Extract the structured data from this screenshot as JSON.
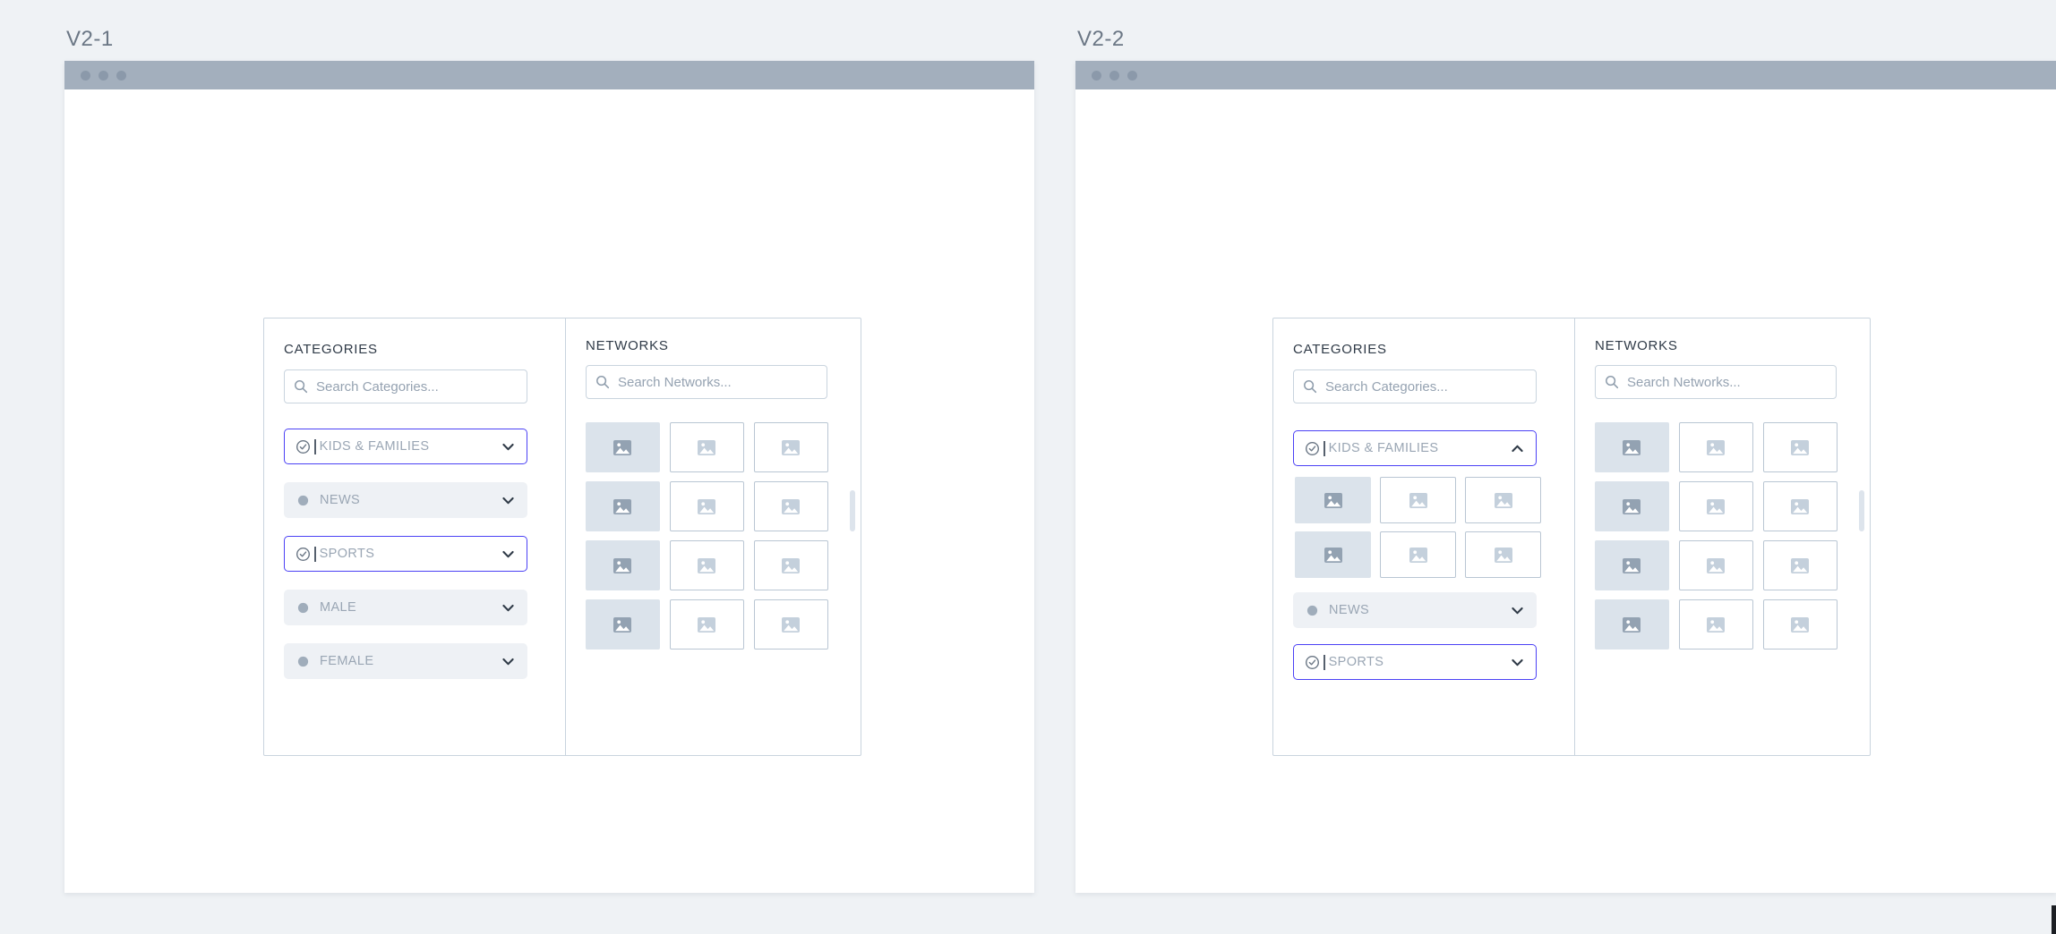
{
  "canvas": {
    "background": "#eff2f5"
  },
  "theme": {
    "accent": "#4b41f5",
    "chrome_bar": "#a3afbd",
    "chrome_dot": "#8b99aa",
    "panel_border": "#c9d4de",
    "row_unselected_bg": "#eef1f5",
    "label_muted": "#9aa6b4",
    "title_color": "#2f3a47",
    "tile_filled": "#dbe3eb",
    "tile_outline_border": "#b9c6d3",
    "scrollbar_thumb": "#dde4ec"
  },
  "artboards": [
    {
      "id": "v2-1",
      "label": "V2-1",
      "categories_panel": {
        "title": "CATEGORIES",
        "search": {
          "placeholder": "Search Categories...",
          "value": "",
          "icon": "search-icon"
        },
        "rows": [
          {
            "label": "KIDS & FAMILIES",
            "state": "selected",
            "marker": "check-circle-icon",
            "chevron": "chevron-down-icon",
            "expanded": false,
            "caret": true
          },
          {
            "label": "NEWS",
            "state": "unselected",
            "marker": "dot-icon",
            "chevron": "chevron-down-icon",
            "expanded": false,
            "caret": false
          },
          {
            "label": "SPORTS",
            "state": "selected",
            "marker": "check-circle-icon",
            "chevron": "chevron-down-icon",
            "expanded": false,
            "caret": true
          },
          {
            "label": "MALE",
            "state": "unselected",
            "marker": "dot-icon",
            "chevron": "chevron-down-icon",
            "expanded": false,
            "caret": false
          },
          {
            "label": "FEMALE",
            "state": "unselected",
            "marker": "dot-icon",
            "chevron": "chevron-down-icon",
            "expanded": false,
            "caret": false
          }
        ]
      },
      "networks_panel": {
        "title": "NETWORKS",
        "search": {
          "placeholder": "Search Networks...",
          "value": "",
          "icon": "search-icon"
        },
        "grid": {
          "columns": 3,
          "rows": 4,
          "tiles": [
            {
              "style": "filled",
              "icon": "image-placeholder-icon"
            },
            {
              "style": "outline",
              "icon": "image-placeholder-icon"
            },
            {
              "style": "outline",
              "icon": "image-placeholder-icon"
            },
            {
              "style": "filled",
              "icon": "image-placeholder-icon"
            },
            {
              "style": "outline",
              "icon": "image-placeholder-icon"
            },
            {
              "style": "outline",
              "icon": "image-placeholder-icon"
            },
            {
              "style": "filled",
              "icon": "image-placeholder-icon"
            },
            {
              "style": "outline",
              "icon": "image-placeholder-icon"
            },
            {
              "style": "outline",
              "icon": "image-placeholder-icon"
            },
            {
              "style": "filled",
              "icon": "image-placeholder-icon"
            },
            {
              "style": "outline",
              "icon": "image-placeholder-icon"
            },
            {
              "style": "outline",
              "icon": "image-placeholder-icon"
            }
          ]
        },
        "scrollbar": {
          "name": "networks-scrollbar-thumb"
        }
      }
    },
    {
      "id": "v2-2",
      "label": "V2-2",
      "categories_panel": {
        "title": "CATEGORIES",
        "search": {
          "placeholder": "Search Categories...",
          "value": "",
          "icon": "search-icon"
        },
        "rows": [
          {
            "label": "KIDS & FAMILIES",
            "state": "selected",
            "marker": "check-circle-icon",
            "chevron": "chevron-up-icon",
            "expanded": true,
            "caret": true
          },
          {
            "label": "NEWS",
            "state": "unselected",
            "marker": "dot-icon",
            "chevron": "chevron-down-icon",
            "expanded": false,
            "caret": false
          },
          {
            "label": "SPORTS",
            "state": "selected",
            "marker": "check-circle-icon",
            "chevron": "chevron-down-icon",
            "expanded": false,
            "caret": true
          }
        ],
        "expanded_grid": {
          "columns": 3,
          "rows": 2,
          "tiles": [
            {
              "style": "filled",
              "icon": "image-placeholder-icon"
            },
            {
              "style": "outline",
              "icon": "image-placeholder-icon"
            },
            {
              "style": "outline",
              "icon": "image-placeholder-icon"
            },
            {
              "style": "filled",
              "icon": "image-placeholder-icon"
            },
            {
              "style": "outline",
              "icon": "image-placeholder-icon"
            },
            {
              "style": "outline",
              "icon": "image-placeholder-icon"
            }
          ]
        }
      },
      "networks_panel": {
        "title": "NETWORKS",
        "search": {
          "placeholder": "Search Networks...",
          "value": "",
          "icon": "search-icon"
        },
        "grid": {
          "columns": 3,
          "rows": 4,
          "tiles": [
            {
              "style": "filled",
              "icon": "image-placeholder-icon"
            },
            {
              "style": "outline",
              "icon": "image-placeholder-icon"
            },
            {
              "style": "outline",
              "icon": "image-placeholder-icon"
            },
            {
              "style": "filled",
              "icon": "image-placeholder-icon"
            },
            {
              "style": "outline",
              "icon": "image-placeholder-icon"
            },
            {
              "style": "outline",
              "icon": "image-placeholder-icon"
            },
            {
              "style": "filled",
              "icon": "image-placeholder-icon"
            },
            {
              "style": "outline",
              "icon": "image-placeholder-icon"
            },
            {
              "style": "outline",
              "icon": "image-placeholder-icon"
            },
            {
              "style": "filled",
              "icon": "image-placeholder-icon"
            },
            {
              "style": "outline",
              "icon": "image-placeholder-icon"
            },
            {
              "style": "outline",
              "icon": "image-placeholder-icon"
            }
          ]
        },
        "scrollbar": {
          "name": "networks-scrollbar-thumb"
        }
      }
    }
  ],
  "window_chrome": {
    "dots": 3
  }
}
